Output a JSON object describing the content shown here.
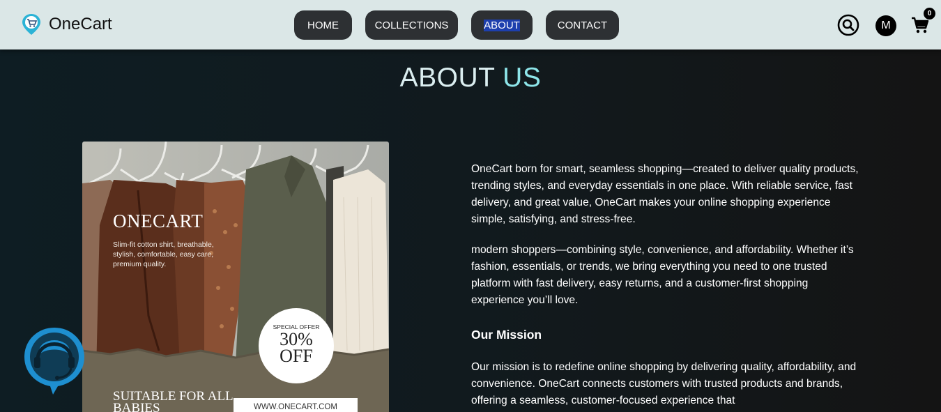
{
  "header": {
    "brand": "OneCart",
    "nav": [
      {
        "label": "HOME"
      },
      {
        "label": "COLLECTIONS"
      },
      {
        "label": "ABOUT"
      },
      {
        "label": "CONTACT"
      }
    ],
    "selected_nav": "ABOUT",
    "avatar_initial": "M",
    "cart_count": "0",
    "icons": [
      "search-icon",
      "cart-icon",
      "cart-logo-icon"
    ]
  },
  "page": {
    "title_part1": "ABOUT",
    "title_part2": "US"
  },
  "banner": {
    "brand": "ONECART",
    "description": "Slim-fit cotton shirt, breathable, stylish, comfortable, easy care, premium quality.",
    "offer_small": "SPECIAL OFFER",
    "offer_percent": "30%",
    "offer_off": "OFF",
    "suitable": "SUITABLE FOR ALL BABIES",
    "url": "WWW.ONECART.COM"
  },
  "content": {
    "para1": "OneCart born for smart, seamless shopping—created to deliver quality products, trending styles, and everyday essentials in one place. With reliable service, fast delivery, and great value, OneCart makes your online shopping experience simple, satisfying, and stress-free.",
    "para2": "modern shoppers—combining style, convenience, and affordability. Whether it’s fashion, essentials, or trends, we bring everything you need to one trusted platform with fast delivery, easy returns, and a customer-first shopping experience you’ll love.",
    "mission_heading": "Our Mission",
    "mission_text": "Our mission is to redefine online shopping by delivering quality, affordability, and convenience. OneCart connects customers with trusted products and brands, offering a seamless, customer-focused experience that"
  },
  "colors": {
    "header_bg": "#dbe7e7",
    "nav_button": "#2d3033",
    "title_accent": "#8ee6ea",
    "support_blue": "#1e8fd0"
  }
}
